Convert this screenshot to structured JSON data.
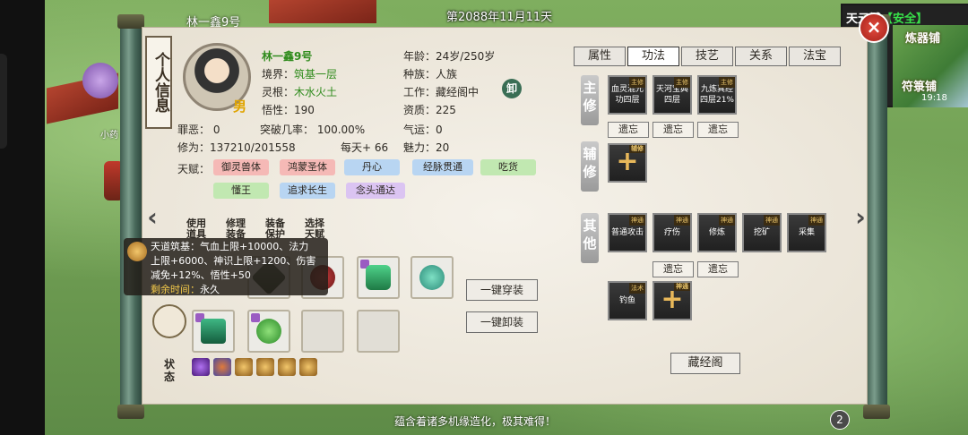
{
  "world": {
    "top_name": "林一鑫9号",
    "date": "第2088年11月11天",
    "npc_label": "小药",
    "bottom_banner": "蕴含着诸多机缘造化，极其难得！",
    "minimap": {
      "status_prefix": "天元城",
      "status_safe": "【安全】",
      "shop1": "炼器铺",
      "shop2": "符箓铺",
      "time": "19:18"
    },
    "badge_count": "2"
  },
  "panel": {
    "side_title": "个人信息",
    "name": "林一鑫9号",
    "gender": "男",
    "stats_left": [
      {
        "label": "境界：",
        "value": "筑基一层",
        "green": true
      },
      {
        "label": "灵根：",
        "value": "木水火土",
        "green": true
      },
      {
        "label": "悟性：",
        "value": "190",
        "green": false
      }
    ],
    "stats_right": [
      {
        "label": "年龄：",
        "value": "24岁/250岁"
      },
      {
        "label": "种族：",
        "value": "人族"
      },
      {
        "label": "工作：",
        "value": "藏经阁中"
      },
      {
        "label": "资质：",
        "value": "225"
      },
      {
        "label": "气运：",
        "value": "0"
      },
      {
        "label": "魅力：",
        "value": "20"
      }
    ],
    "unequip_badge": "卸",
    "sin": "罪恶：  0",
    "breakthrough": "突破几率：  100.00%",
    "cultivation": "修为：137210/201558",
    "daily": "每天+ 66",
    "talent_label": "天赋：",
    "talents": [
      {
        "text": "御灵兽体",
        "color": "red"
      },
      {
        "text": "鸿蒙圣体",
        "color": "red"
      },
      {
        "text": "丹心",
        "color": "blue"
      },
      {
        "text": "经脉贯通",
        "color": "blue"
      },
      {
        "text": "吃货",
        "color": "green"
      },
      {
        "text": "懂王",
        "color": "green"
      },
      {
        "text": "追求长生",
        "color": "blue"
      },
      {
        "text": "念头通达",
        "color": "purple"
      }
    ],
    "tabs": [
      {
        "label": "属性",
        "active": false
      },
      {
        "label": "功法",
        "active": true
      },
      {
        "label": "技艺",
        "active": false
      },
      {
        "label": "关系",
        "active": false
      },
      {
        "label": "法宝",
        "active": false
      }
    ],
    "sections": {
      "main": "主修",
      "aux": "辅修",
      "other": "其他"
    },
    "main_skills": [
      {
        "name": "血灵混元功四层",
        "tag": "主修"
      },
      {
        "name": "天河宝典四层",
        "tag": "主修"
      },
      {
        "name": "九炼真经四层21%",
        "tag": "主修"
      }
    ],
    "aux_tag": "辅修",
    "other_skills": [
      {
        "name": "普通攻击",
        "tag": "神通"
      },
      {
        "name": "疗伤",
        "tag": "神通"
      },
      {
        "name": "修炼",
        "tag": "神通"
      },
      {
        "name": "挖矿",
        "tag": "神通"
      },
      {
        "name": "采集",
        "tag": "神通"
      }
    ],
    "other_skills_row2": [
      {
        "name": "钓鱼",
        "tag": "法术"
      }
    ],
    "other_add_tag": "神通",
    "forget": "遗忘",
    "scripture_btn": "藏经阁",
    "equip_tabs": [
      "使用道具",
      "修理装备",
      "装备保护",
      "选择天赋"
    ],
    "equip_all": "一键穿装",
    "unequip_all": "一键卸装",
    "status_label": "状态",
    "tooltip": {
      "line1": "天道筑基：气血上限+10000、法力",
      "line2": "上限+6000、神识上限+1200、伤害",
      "line3": "减免+12%、悟性+50",
      "remain_label": "剩余时间：",
      "remain_value": "永久"
    }
  },
  "colors": {
    "accent_green": "#2f8b1c",
    "gender_gold": "#e0a400",
    "close_red": "#d33a2c"
  }
}
